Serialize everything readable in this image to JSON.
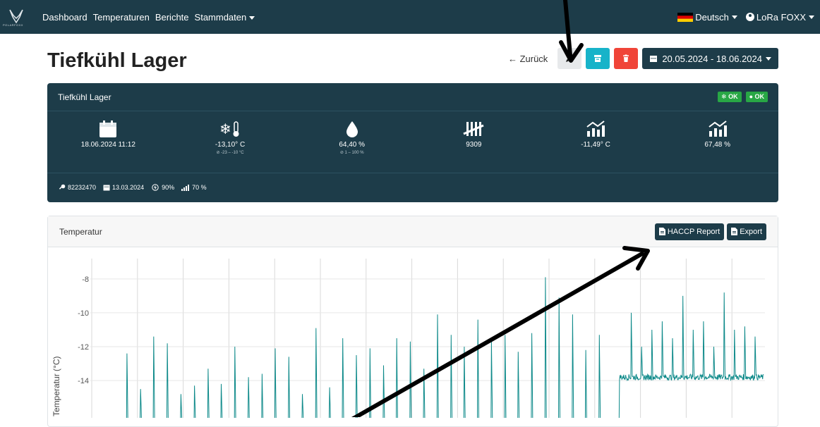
{
  "nav": {
    "brand": "POLARFOXX",
    "links": [
      "Dashboard",
      "Temperaturen",
      "Berichte",
      "Stammdaten"
    ],
    "language": "Deutsch",
    "user": "LoRa FOXX"
  },
  "header": {
    "title": "Tiefkühl Lager",
    "back_label": "← Zurück",
    "date_range": "20.05.2024 - 18.06.2024"
  },
  "sensor": {
    "name": "Tiefkühl Lager",
    "badges": [
      "OK",
      "OK"
    ],
    "stats": [
      {
        "icon": "calendar-icon",
        "value": "18.06.2024 11:12",
        "sub": ""
      },
      {
        "icon": "freeze-thermometer-icon",
        "value": "-13,10° C",
        "sub": "⊘ -23 – -10 °C"
      },
      {
        "icon": "humidity-drop-icon",
        "value": "64,40 %",
        "sub": "⊘ 1 – 100 %"
      },
      {
        "icon": "counter-icon",
        "value": "9309",
        "sub": ""
      },
      {
        "icon": "trend-chart-icon",
        "value": "-11,49° C",
        "sub": ""
      },
      {
        "icon": "trend-chart-icon",
        "value": "67,48 %",
        "sub": ""
      }
    ],
    "footer": {
      "id": "82232470",
      "date": "13.03.2024",
      "battery": "90%",
      "signal": "70 %"
    }
  },
  "chart_card": {
    "title": "Temperatur",
    "haccp_label": "HACCP Report",
    "export_label": "Export"
  },
  "chart_data": {
    "type": "line",
    "ylabel": "Temperatur (°C)",
    "yticks": [
      -8,
      -10,
      -12,
      -14
    ],
    "ylim": [
      -16.2,
      -6.8
    ],
    "grid": true,
    "series_color": "#0e8a8a",
    "baseline_early": -16.5,
    "baseline_late": -13.8,
    "regime_change_fraction": 0.78,
    "spikes_early": [
      -12.4,
      -14.5,
      -11.4,
      -11.8,
      -14.8,
      -14.3,
      -13.3,
      -14.2,
      -12.0,
      -13.8,
      -13.6,
      -12.1,
      -12.6,
      -14.8,
      -10.9,
      -14.4,
      -11.5,
      -12.5,
      -12.1,
      -13.1,
      -11.5,
      -11.7,
      -13.3,
      -10.1,
      -11.3,
      -12.0,
      -10.4,
      -11.7,
      -11.3,
      -12.3,
      -11.2,
      -7.9,
      -9.1,
      -10.1,
      -12.2,
      -11.3
    ],
    "spikes_late": [
      -10.0,
      -12.0,
      -11.0,
      -10.5,
      -11.5,
      -9.0,
      -11.0,
      -10.5,
      -12.0,
      -8.8,
      -11.0,
      -10.8,
      -11.4
    ]
  }
}
